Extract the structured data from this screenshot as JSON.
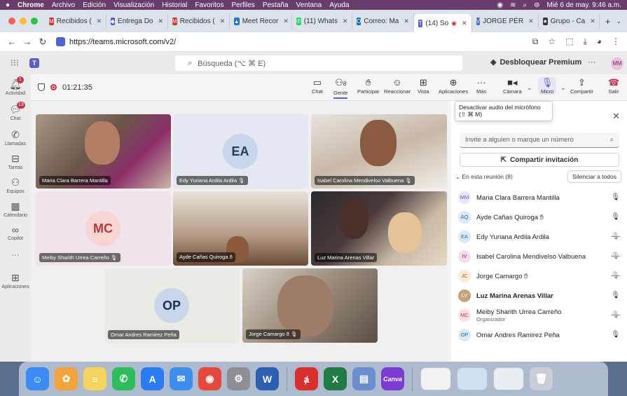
{
  "menubar": {
    "items": [
      "Chrome",
      "Archivo",
      "Edición",
      "Visualización",
      "Historial",
      "Favoritos",
      "Perfiles",
      "Pestaña",
      "Ventana",
      "Ayuda"
    ],
    "datetime": "Mié 6 de may. 9:46 a.m."
  },
  "tabs": [
    {
      "label": "Recibidos (",
      "icon": "gmail-icon",
      "color": "#d93025"
    },
    {
      "label": "Entrega Do",
      "icon": "diamond-icon",
      "color": "#4a63d6"
    },
    {
      "label": "Recibidos (",
      "icon": "gmail-icon",
      "color": "#d93025"
    },
    {
      "label": "Meet Recor",
      "icon": "drive-icon",
      "color": "#1a73e8"
    },
    {
      "label": "(11) Whats",
      "icon": "whatsapp-icon",
      "color": "#25d366"
    },
    {
      "label": "Correo: Ma",
      "icon": "outlook-icon",
      "color": "#0f6cbd"
    },
    {
      "label": "(14) So",
      "icon": "teams-icon",
      "color": "#5b5fc7"
    },
    {
      "label": "JORGE PÉR",
      "icon": "v-icon",
      "color": "#3b6fd8"
    },
    {
      "label": "Grupo - Ca",
      "icon": "star-icon",
      "color": "#333333"
    }
  ],
  "address": {
    "url": "https://teams.microsoft.com/v2/"
  },
  "teams": {
    "search_placeholder": "Búsqueda (⌥ ⌘ E)",
    "premium_label": "Desbloquear Premium",
    "more": "···",
    "me_initials": "MM"
  },
  "rail": [
    {
      "label": "Actividad",
      "icon": "bell-icon",
      "badge": "1"
    },
    {
      "label": "Chat",
      "icon": "chat-icon",
      "badge": "13"
    },
    {
      "label": "Llamadas",
      "icon": "phone-icon",
      "badge": ""
    },
    {
      "label": "Tareas",
      "icon": "tasks-icon",
      "badge": ""
    },
    {
      "label": "Equipos",
      "icon": "teams-group-icon",
      "badge": ""
    },
    {
      "label": "Calendario",
      "icon": "calendar-icon",
      "badge": ""
    },
    {
      "label": "Copilot",
      "icon": "copilot-icon",
      "badge": ""
    },
    {
      "label": "···",
      "icon": "more-icon",
      "badge": ""
    },
    {
      "label": "Aplicaciones",
      "icon": "apps-icon",
      "badge": ""
    }
  ],
  "meeting": {
    "timer": "01:21:35",
    "people_count": "8",
    "controls": {
      "chat": "Chat",
      "people": "Gente",
      "raise": "Participar",
      "react": "Reaccionar",
      "view": "Vista",
      "apps": "Aplicaciones",
      "more": "Más",
      "camera": "Cámara",
      "mic": "Micro",
      "share": "Compartir",
      "leave": "Salir"
    },
    "tooltip": "Desactivar audio del micrófono (⇧ ⌘ M)"
  },
  "tiles": [
    {
      "name": "Maria Clara Barrera Mantilla",
      "initials": "",
      "kind": "video"
    },
    {
      "name": "Edy Yuriana Ardila Ardila",
      "initials": "EA",
      "kind": "avatar"
    },
    {
      "name": "Isabel Carolina Mendivelso Valbuena",
      "initials": "",
      "kind": "video"
    },
    {
      "name": "Meiby Sharith Urrea Carreño",
      "initials": "MC",
      "kind": "avatar"
    },
    {
      "name": "Ayde Cañas Quiroga",
      "initials": "",
      "kind": "video"
    },
    {
      "name": "Luz Marina Arenas Villar",
      "initials": "",
      "kind": "video"
    },
    {
      "name": "Omar Andres Ramirez Peña",
      "initials": "OP",
      "kind": "avatar"
    },
    {
      "name": "Jorge Camargo",
      "initials": "",
      "kind": "video"
    }
  ],
  "panel": {
    "invite_placeholder": "Invite a alguien o marque un número",
    "share_invite": "Compartir invitación",
    "in_meeting": "En esta reunión (8)",
    "silence_all": "Silenciar a todos",
    "participants": [
      {
        "initials": "MM",
        "name": "Maria Clara Barrera Mantilla",
        "sub": "",
        "bold": false,
        "mic": "mic-on",
        "bg": "#e8e6f7",
        "fg": "#5b5fc7"
      },
      {
        "initials": "AQ",
        "name": "Ayde Cañas Quiroga",
        "sub": "",
        "bold": false,
        "mic": "mic-on",
        "bg": "#dbe9f7",
        "fg": "#0f6cbd",
        "hand": true
      },
      {
        "initials": "EA",
        "name": "Edy Yuriana Ardila Ardila",
        "sub": "",
        "bold": false,
        "mic": "mic-off",
        "bg": "#dbe9f7",
        "fg": "#0f6cbd"
      },
      {
        "initials": "IV",
        "name": "Isabel Carolina Mendivelso Valbuena",
        "sub": "",
        "bold": false,
        "mic": "mic-off",
        "bg": "#f7dde9",
        "fg": "#b4009e"
      },
      {
        "initials": "JC",
        "name": "Jorge Camargo",
        "sub": "",
        "bold": false,
        "mic": "mic-off",
        "bg": "#fbecd8",
        "fg": "#a0621e",
        "hand": true
      },
      {
        "initials": "LV",
        "name": "Luz Marina Arenas Villar",
        "sub": "",
        "bold": true,
        "mic": "mic-on",
        "bg": "#c6a27a",
        "fg": "#ffffff"
      },
      {
        "initials": "MC",
        "name": "Meiby Sharith Urrea Carreño",
        "sub": "Organizador",
        "bold": false,
        "mic": "mic-off",
        "bg": "#fbe0df",
        "fg": "#c4314b"
      },
      {
        "initials": "OP",
        "name": "Omar Andres Ramirez Peña",
        "sub": "",
        "bold": false,
        "mic": "mic-on",
        "bg": "#dbe9f7",
        "fg": "#0f6cbd"
      }
    ]
  },
  "dock": [
    {
      "name": "finder",
      "color": "#3a8bf5",
      "glyph": "☺"
    },
    {
      "name": "photos",
      "color": "#f4a23a",
      "glyph": "✿"
    },
    {
      "name": "notes",
      "color": "#f6d35b",
      "glyph": "≡"
    },
    {
      "name": "whatsapp",
      "color": "#2bbf5c",
      "glyph": "✆"
    },
    {
      "name": "app-store",
      "color": "#2a7cf6",
      "glyph": "A"
    },
    {
      "name": "mail",
      "color": "#3d8ef0",
      "glyph": "✉"
    },
    {
      "name": "chrome",
      "color": "#e8483b",
      "glyph": "◉"
    },
    {
      "name": "settings",
      "color": "#8e8e93",
      "glyph": "⚙"
    },
    {
      "name": "word",
      "color": "#2b5fb4",
      "glyph": "W"
    },
    {
      "name": "acrobat",
      "color": "#d9302c",
      "glyph": "ⱥ"
    },
    {
      "name": "excel",
      "color": "#1f7a44",
      "glyph": "X"
    },
    {
      "name": "preview",
      "color": "#6a8fd0",
      "glyph": "▤"
    },
    {
      "name": "canva",
      "color": "#7d3bd6",
      "glyph": "Canva"
    },
    {
      "name": "document-window",
      "color": "#f2f2f2",
      "glyph": ""
    },
    {
      "name": "screenshot-window",
      "color": "#cfe0f0",
      "glyph": ""
    },
    {
      "name": "spreadsheet-window",
      "color": "#e9eef3",
      "glyph": ""
    },
    {
      "name": "trash",
      "color": "#c9ced6",
      "glyph": "🗑"
    }
  ]
}
